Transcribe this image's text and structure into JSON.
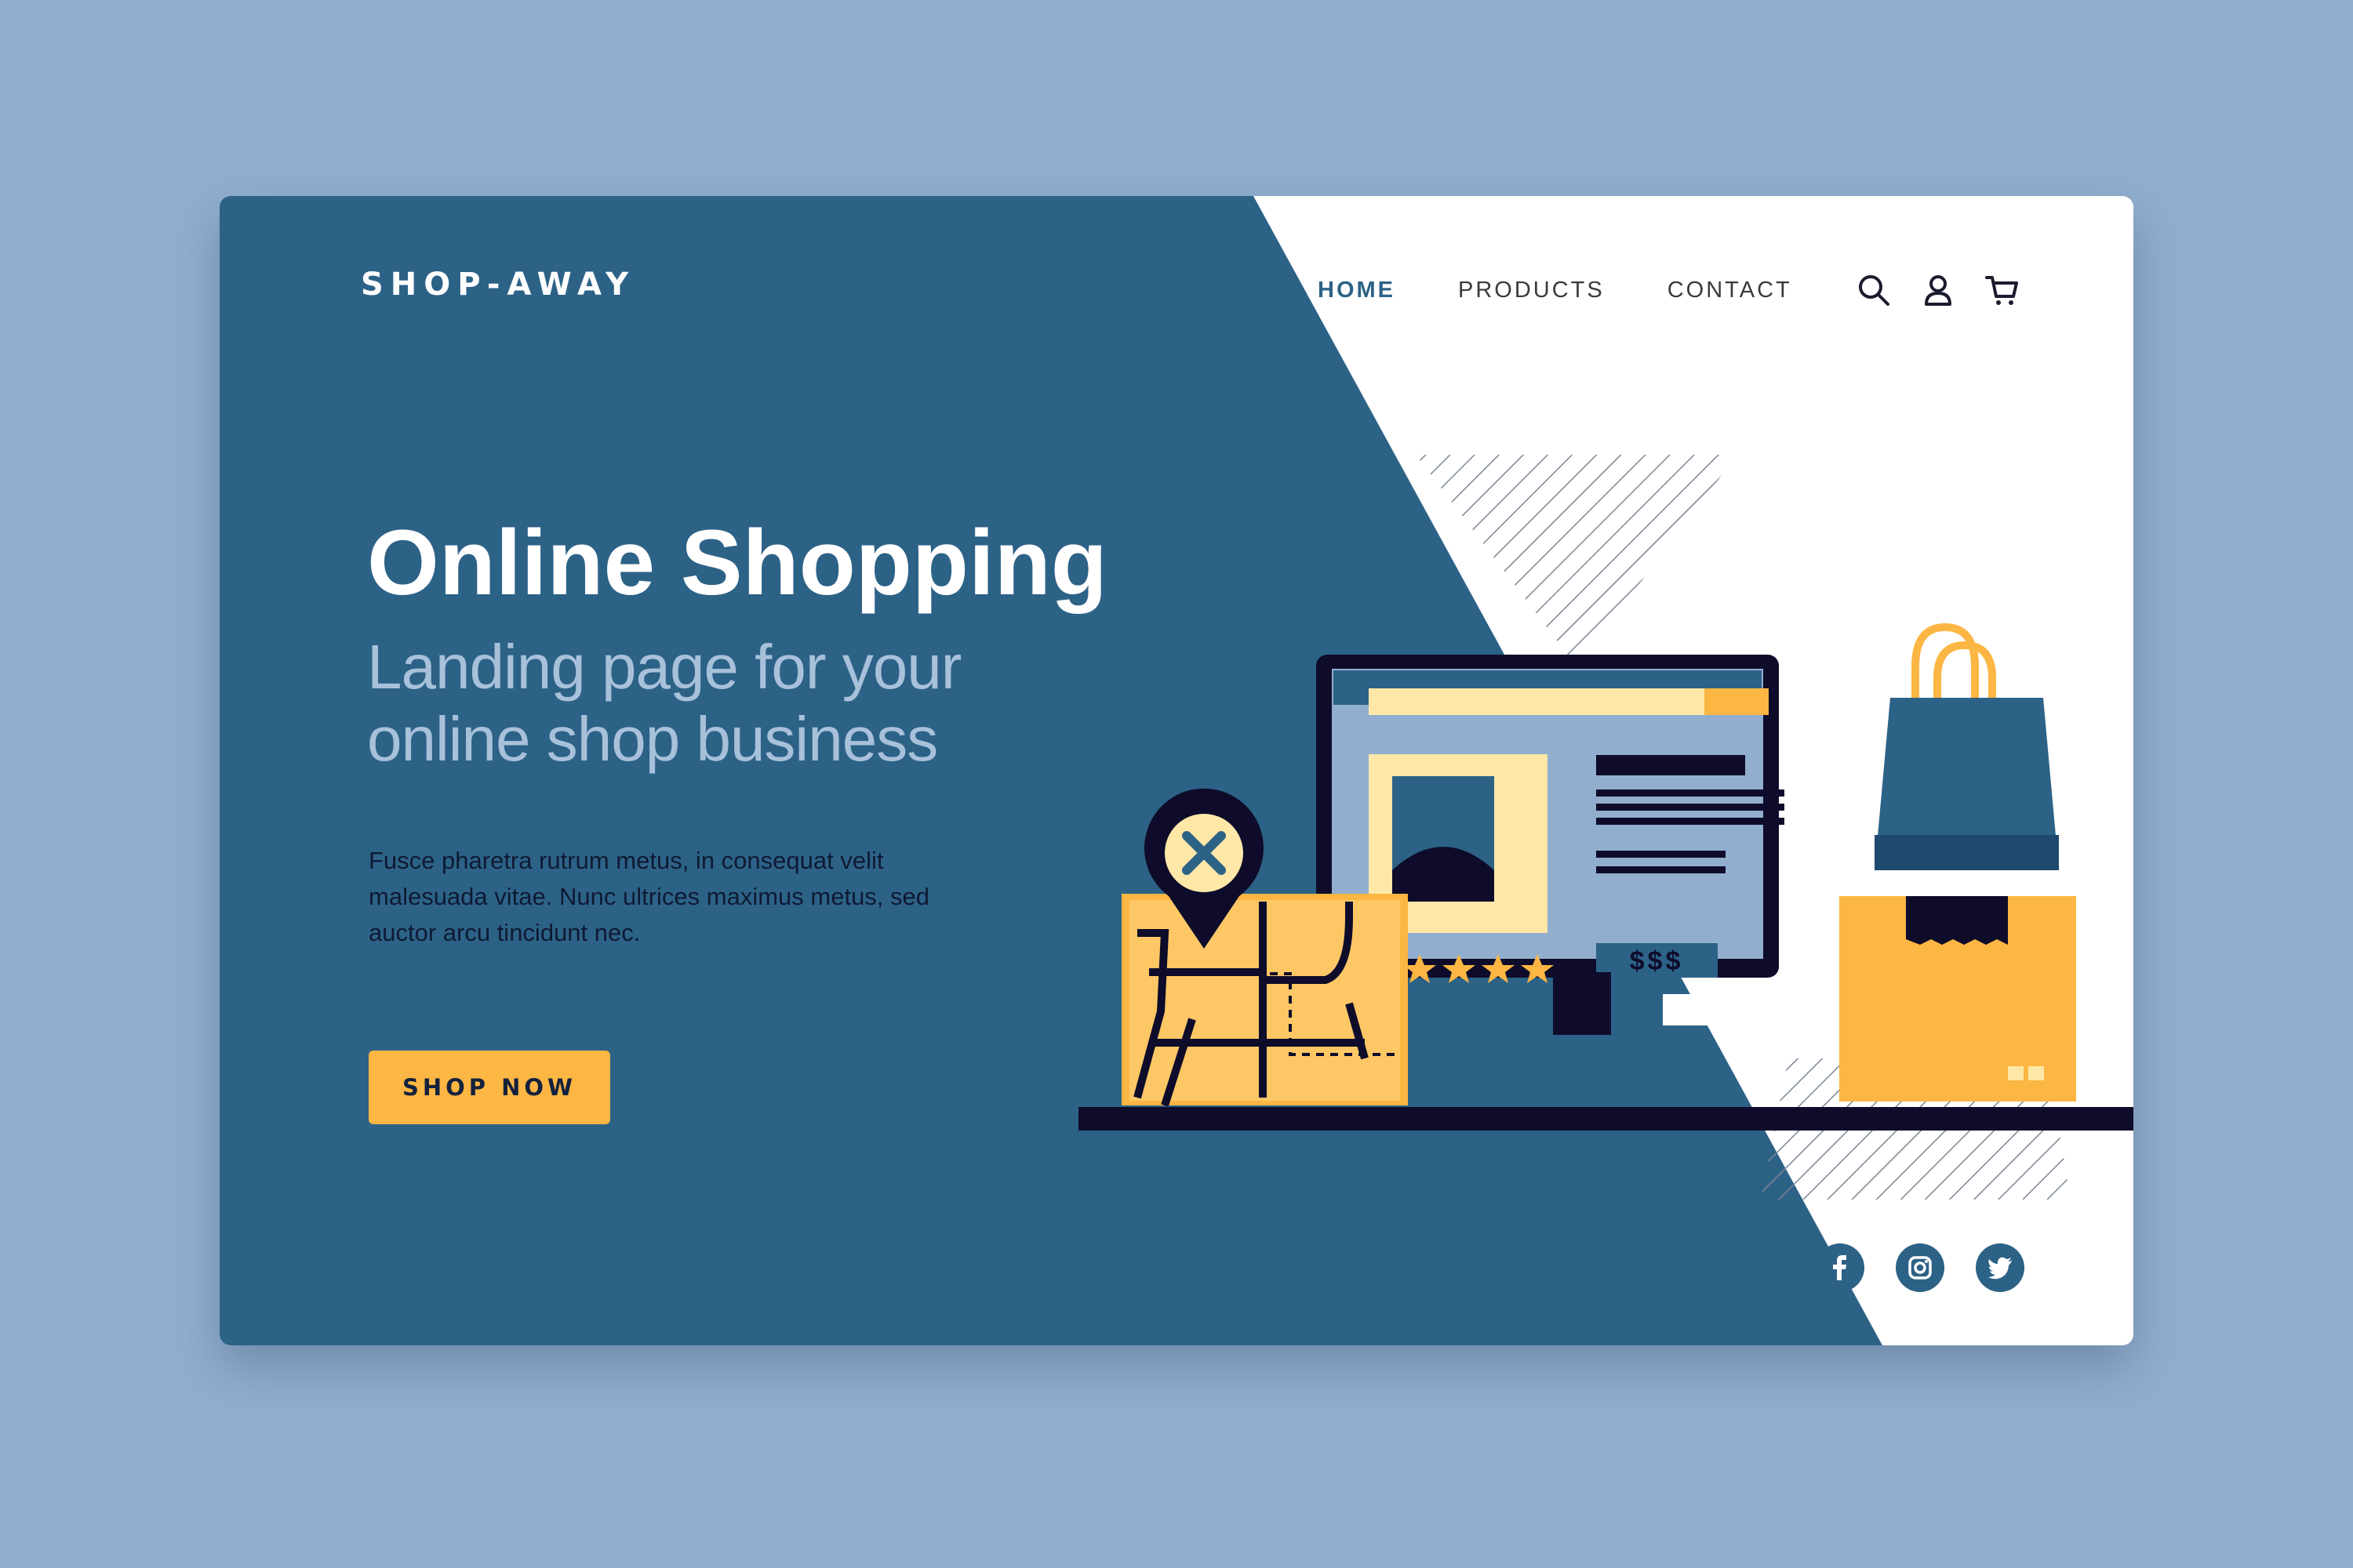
{
  "brand": {
    "logo": "SHOP-AWAY"
  },
  "nav": {
    "items": [
      {
        "label": "HOME",
        "active": true
      },
      {
        "label": "PRODUCTS",
        "active": false
      },
      {
        "label": "CONTACT",
        "active": false
      }
    ],
    "icons": [
      "search-icon",
      "user-icon",
      "cart-icon"
    ]
  },
  "hero": {
    "title": "Online Shopping",
    "subtitle_line1": "Landing page for your",
    "subtitle_line2": "online shop business",
    "body": "Fusce pharetra rutrum metus, in consequat velit malesuada vitae. Nunc ultrices maximus metus, sed auctor arcu tincidunt nec.",
    "cta": "SHOP NOW"
  },
  "illustration": {
    "price_tag": "$$$",
    "rating_stars": 4
  },
  "social": [
    "facebook-icon",
    "instagram-icon",
    "twitter-icon"
  ],
  "colors": {
    "background": "#91aece",
    "primary": "#2d6287",
    "accent": "#fcb643",
    "dark": "#0e0c2a",
    "light_blue": "#91aece",
    "cream": "#ffe7a8"
  }
}
